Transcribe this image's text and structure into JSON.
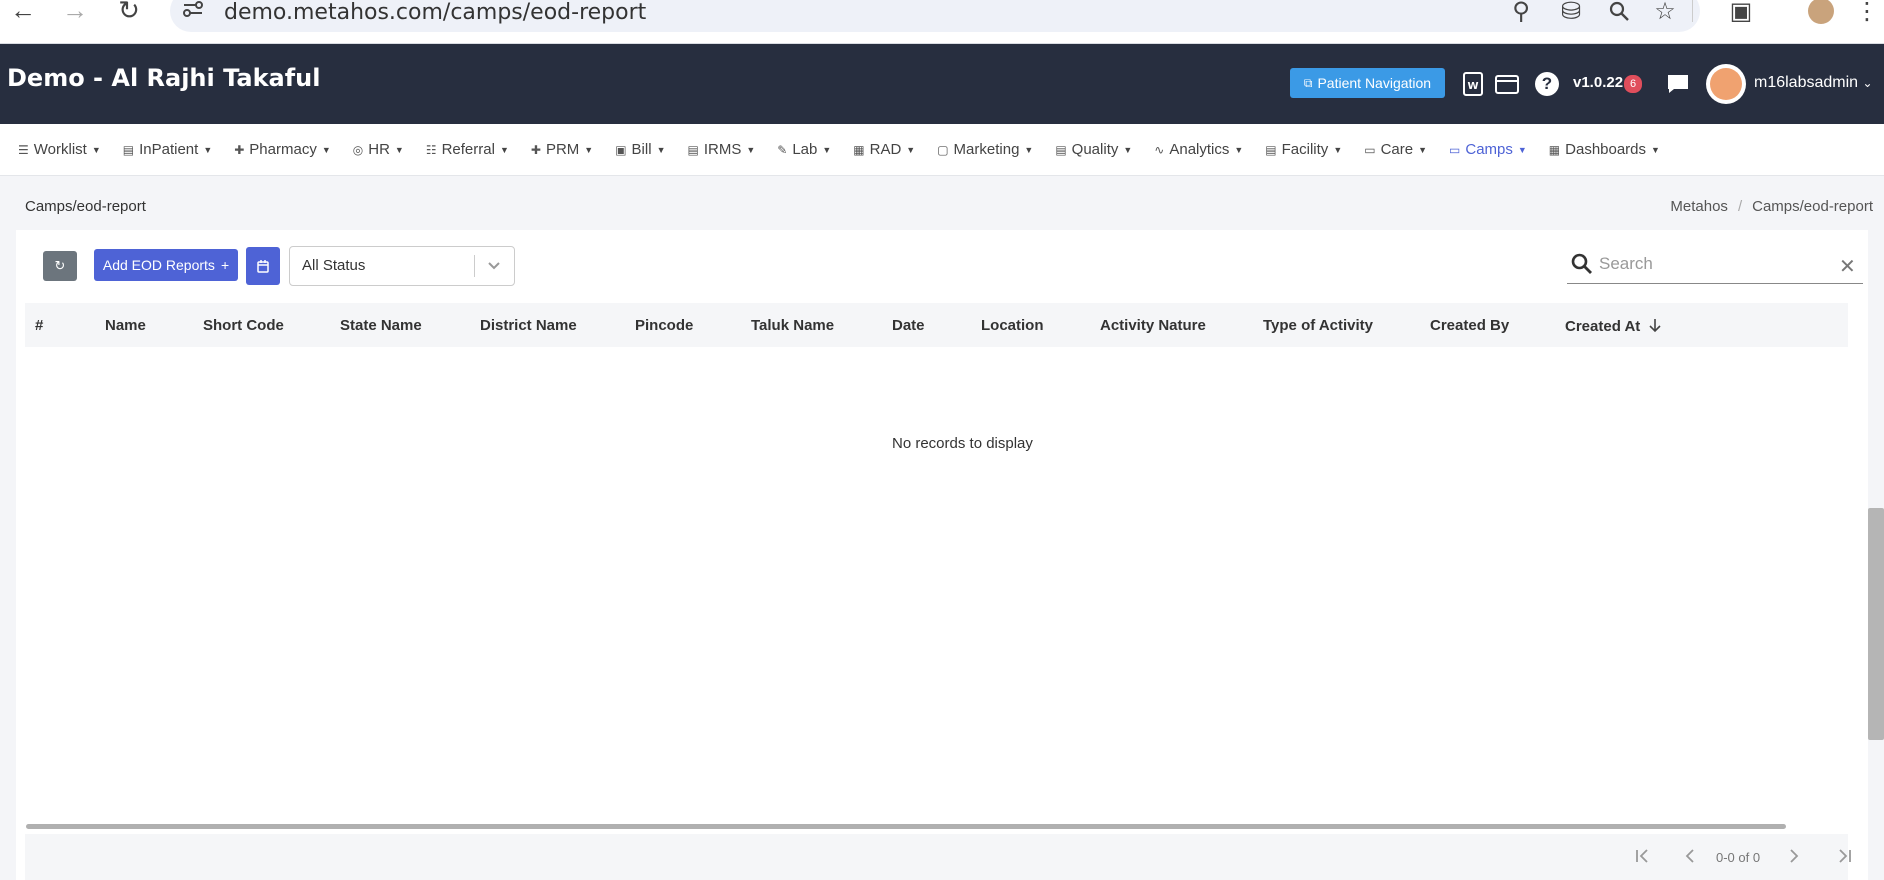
{
  "browser": {
    "url": "demo.metahos.com/camps/eod-report"
  },
  "header": {
    "title": "Demo - Al Rajhi Takaful",
    "patient_nav_label": "Patient Navigation",
    "version": "v1.0.22",
    "version_badge": "6",
    "username": "m16labsadmin",
    "colors": {
      "header_bg": "#272e3f",
      "accent": "#4e63d6",
      "patient_nav": "#3b9ae6",
      "badge": "#e04e5c"
    }
  },
  "nav": {
    "items": [
      {
        "label": "Worklist",
        "icon": "list-icon"
      },
      {
        "label": "InPatient",
        "icon": "building-icon"
      },
      {
        "label": "Pharmacy",
        "icon": "plus-icon"
      },
      {
        "label": "HR",
        "icon": "user-circle-icon"
      },
      {
        "label": "Referral",
        "icon": "user-list-icon"
      },
      {
        "label": "PRM",
        "icon": "plus-icon"
      },
      {
        "label": "Bill",
        "icon": "money-icon"
      },
      {
        "label": "IRMS",
        "icon": "card-icon"
      },
      {
        "label": "Lab",
        "icon": "pencil-icon"
      },
      {
        "label": "RAD",
        "icon": "film-icon"
      },
      {
        "label": "Marketing",
        "icon": "bag-icon"
      },
      {
        "label": "Quality",
        "icon": "id-card-icon"
      },
      {
        "label": "Analytics",
        "icon": "pulse-icon"
      },
      {
        "label": "Facility",
        "icon": "building-icon"
      },
      {
        "label": "Care",
        "icon": "bed-icon"
      },
      {
        "label": "Camps",
        "icon": "tent-icon",
        "active": true
      },
      {
        "label": "Dashboards",
        "icon": "grid-icon"
      }
    ]
  },
  "page": {
    "path": "Camps/eod-report",
    "breadcrumb": [
      "Metahos",
      "Camps/eod-report"
    ]
  },
  "toolbar": {
    "add_label": "Add EOD Reports",
    "add_suffix": "+",
    "status_value": "All Status",
    "search_placeholder": "Search"
  },
  "table": {
    "columns": [
      "#",
      "Name",
      "Short Code",
      "State Name",
      "District Name",
      "Pincode",
      "Taluk Name",
      "Date",
      "Location",
      "Activity Nature",
      "Type of Activity",
      "Created By",
      "Created At"
    ],
    "sort_column": "Created At",
    "sort_direction": "desc",
    "empty_message": "No records to display",
    "pagination": "0-0 of 0"
  }
}
